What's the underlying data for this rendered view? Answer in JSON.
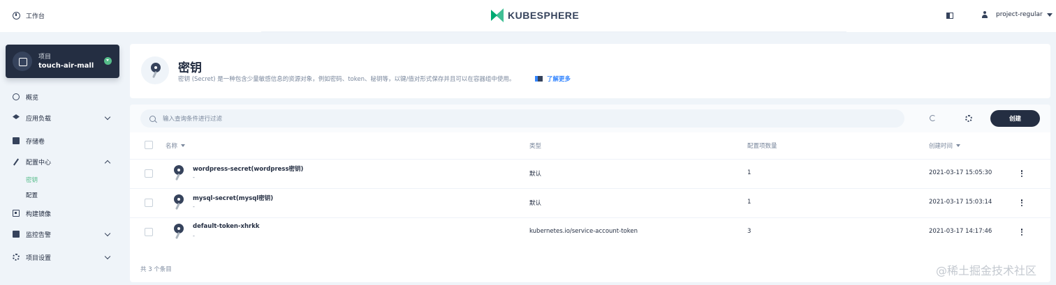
{
  "topbar": {
    "workbench_label": "工作台",
    "logo_text": "KUBESPHERE",
    "username": "project-regular"
  },
  "sidebar": {
    "project": {
      "label": "项目",
      "name": "touch-air-mall"
    },
    "items": [
      {
        "label": "概览",
        "icon": "dashboard-icon"
      },
      {
        "label": "应用负载",
        "icon": "layers-icon"
      },
      {
        "label": "存储卷",
        "icon": "storage-icon"
      },
      {
        "label": "配置中心",
        "icon": "pen-icon"
      },
      {
        "label": "构建镜像",
        "icon": "image-icon"
      },
      {
        "label": "监控告警",
        "icon": "monitor-icon"
      },
      {
        "label": "项目设置",
        "icon": "gear-icon"
      }
    ],
    "config_sub": [
      {
        "label": "密钥",
        "active": true
      },
      {
        "label": "配置",
        "active": false
      }
    ]
  },
  "header": {
    "title": "密钥",
    "description": "密钥 (Secret) 是一种包含少量敏感信息的资源对象，例如密码、token、秘钥等，以键/值对形式保存并且可以在容器组中使用。",
    "learn_more": "了解更多"
  },
  "toolbar": {
    "search_placeholder": "输入查询条件进行过滤",
    "create_label": "创建"
  },
  "table": {
    "columns": [
      "名称",
      "类型",
      "配置项数量",
      "创建时间"
    ],
    "rows": [
      {
        "name": "wordpress-secret(wordpress密钥)",
        "sub": "-",
        "type": "默认",
        "count": "1",
        "created": "2021-03-17 15:05:30"
      },
      {
        "name": "mysql-secret(mysql密钥)",
        "sub": "-",
        "type": "默认",
        "count": "1",
        "created": "2021-03-17 15:03:14"
      },
      {
        "name": "default-token-xhrkk",
        "sub": "-",
        "type": "kubernetes.io/service-account-token",
        "count": "3",
        "created": "2021-03-17 14:17:46"
      }
    ],
    "footer": "共 3 个条目"
  },
  "watermark": "@稀土掘金技术社区",
  "colors": {
    "brand": "#00aa72",
    "active": "#55bc8a",
    "dark": "#242e42",
    "link": "#3385ff"
  }
}
